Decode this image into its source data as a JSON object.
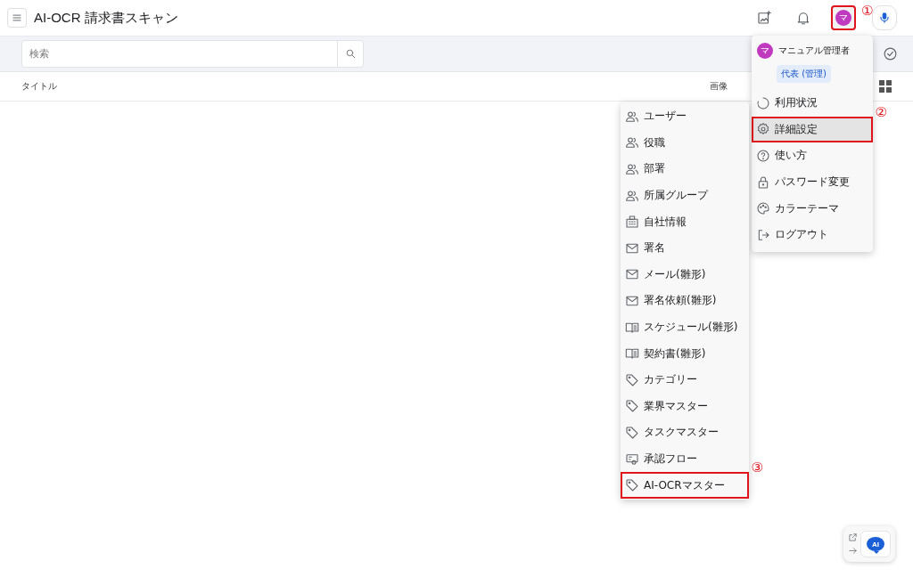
{
  "app_bar": {
    "title": "AI-OCR 請求書スキャン",
    "avatar_letter": "マ",
    "avatar_annotation": "①"
  },
  "search": {
    "placeholder": "検索"
  },
  "table": {
    "columns": [
      "タイトル",
      "画像"
    ]
  },
  "user_menu": {
    "name": "マニュアル管理者",
    "role": "代表 (管理)",
    "avatar_letter": "マ",
    "items": [
      {
        "label": "利用状況",
        "kind": "ring",
        "selected": false
      },
      {
        "label": "詳細設定",
        "kind": "gear",
        "selected": true,
        "annotation": "②"
      },
      {
        "label": "使い方",
        "kind": "help",
        "selected": false
      },
      {
        "label": "パスワード変更",
        "kind": "lock",
        "selected": false
      },
      {
        "label": "カラーテーマ",
        "kind": "palette",
        "selected": false
      },
      {
        "label": "ログアウト",
        "kind": "logout",
        "selected": false
      }
    ]
  },
  "settings_menu": {
    "items": [
      {
        "label": "ユーザー",
        "kind": "people"
      },
      {
        "label": "役職",
        "kind": "people"
      },
      {
        "label": "部署",
        "kind": "people"
      },
      {
        "label": "所属グループ",
        "kind": "people"
      },
      {
        "label": "自社情報",
        "kind": "building"
      },
      {
        "label": "署名",
        "kind": "mail"
      },
      {
        "label": "メール(雛形)",
        "kind": "mail"
      },
      {
        "label": "署名依頼(雛形)",
        "kind": "mail"
      },
      {
        "label": "スケジュール(雛形)",
        "kind": "book"
      },
      {
        "label": "契約書(雛形)",
        "kind": "book"
      },
      {
        "label": "カテゴリー",
        "kind": "tag"
      },
      {
        "label": "業界マスター",
        "kind": "tag"
      },
      {
        "label": "タスクマスター",
        "kind": "tag"
      },
      {
        "label": "承認フロー",
        "kind": "flow"
      },
      {
        "label": "AI-OCRマスター",
        "kind": "tag",
        "annotation": "③"
      }
    ]
  },
  "ai_widget": {
    "badge": "AI"
  }
}
